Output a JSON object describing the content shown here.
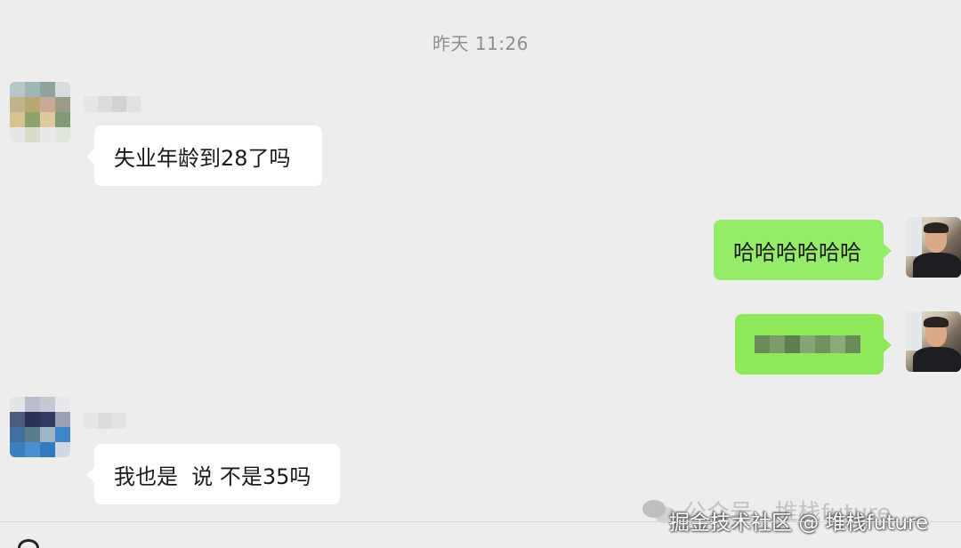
{
  "chat": {
    "timestamp": "昨天 11:26",
    "messages": [
      {
        "side": "left",
        "text": "失业年龄到28了吗"
      },
      {
        "side": "right",
        "text": "哈哈哈哈哈哈"
      },
      {
        "side": "right",
        "text": ""
      },
      {
        "side": "left",
        "text": "我也是  说 不是35吗"
      }
    ]
  },
  "watermark": {
    "faint_text": "公众号 · 堆栈future",
    "strong_text": "掘金技术社区 @ 堆栈future"
  },
  "colors": {
    "background": "#ededed",
    "incoming_bubble": "#ffffff",
    "outgoing_bubble": "#95ec69",
    "timestamp_text": "#8f8f8f"
  }
}
